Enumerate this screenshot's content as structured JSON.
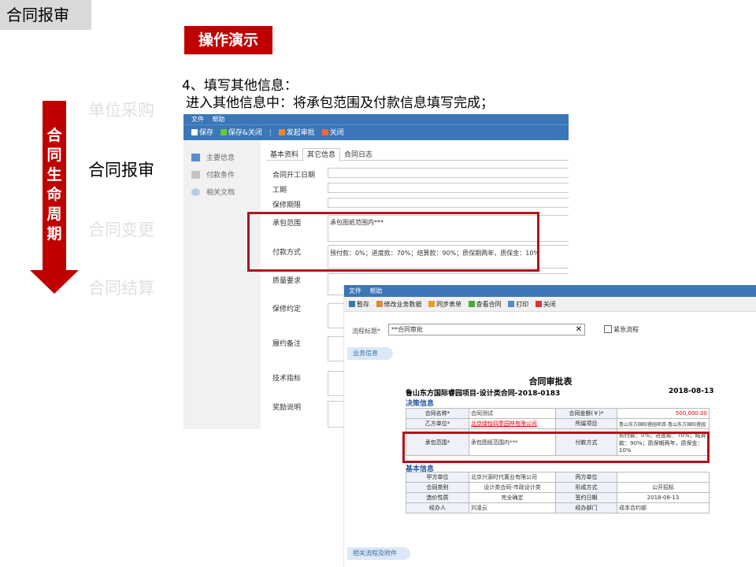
{
  "header": {
    "title": "合同报审",
    "demo_label": "操作演示"
  },
  "step": {
    "line1": "4、填写其他信息：",
    "line2": "进入其他信息中：将承包范围及付款信息填写完成；"
  },
  "lifecycle": {
    "label": "合同生命周期",
    "stages": [
      "单位采购",
      "合同报审",
      "合同变更",
      "合同结算"
    ],
    "active_index": 1
  },
  "window1": {
    "menu": [
      "文件",
      "帮助"
    ],
    "toolbar": [
      "保存",
      "保存&关闭",
      "发起审批",
      "关闭"
    ],
    "sidebar": [
      "主要信息",
      "付款条件",
      "相关文档"
    ],
    "tabs": [
      "基本资料",
      "其它信息",
      "合同日志"
    ],
    "active_tab": 1,
    "fields": {
      "start_date": "合同开工日期",
      "period": "工期",
      "warranty_period": "保修期限",
      "scope_label": "承包范围",
      "scope_value": "承包图纸范围内***",
      "payment_label": "付款方式",
      "payment_value": "预付款：0%；进度款：70%；结算款：90%；质保期两年，质保金：10%",
      "quality": "质量要求",
      "warranty_terms": "保修约定",
      "notes": "履约备注",
      "tech": "技术指标",
      "reward": "奖励说明"
    }
  },
  "window2": {
    "menu": [
      "文件",
      "帮助"
    ],
    "toolbar": [
      "暂存",
      "修改业务数据",
      "同步表单",
      "查看合同",
      "打印",
      "关闭"
    ],
    "flow_title_label": "流程标题*",
    "flow_title_value": "**合同审批",
    "urgent_label": "紧急流程",
    "business_info": "业务信息",
    "related": "相关流程及附件",
    "form": {
      "title": "合同审批表",
      "project": "鲁山东方国际睿园项目-设计类合同-2018-0183",
      "date": "2018-08-13",
      "decision_section": "决策信息",
      "basic_section": "基本信息",
      "contract_name_label": "合同名称*",
      "contract_name": "合同测试",
      "amount_label": "合同金额(￥)*",
      "amount": "500,000.00",
      "partyb_label": "乙方单位*",
      "partyb": "北京绿怡四季园林有限公司",
      "project_label": "所属项目",
      "project_value": "鲁山东方国际睿园项目-鲁山东方国际睿园",
      "scope_label": "承包范围*",
      "scope": "承包图纸范围内***",
      "payment_label": "付款方式",
      "payment": "预付款：0%；进度款：70%；结算款：90%；质保期两年，质保金：10%",
      "partya_label": "甲方单位",
      "partya": "北京兴源时代置业有限公司",
      "partyc_label": "丙方单位",
      "partyc": "",
      "category_label": "合同类别",
      "category": "设计类合同-市政设计类",
      "form_label": "形成方式",
      "form_value": "公开招标",
      "price_label": "造价性质",
      "price": "完全确定",
      "sign_label": "签约日期",
      "sign": "2018-08-13",
      "handler_label": "经办人",
      "handler": "刘凌云",
      "dept_label": "经办部门",
      "dept": "成本合约部"
    }
  },
  "colors": {
    "accent": "#c00000",
    "window_blue": "#3b76b8"
  }
}
